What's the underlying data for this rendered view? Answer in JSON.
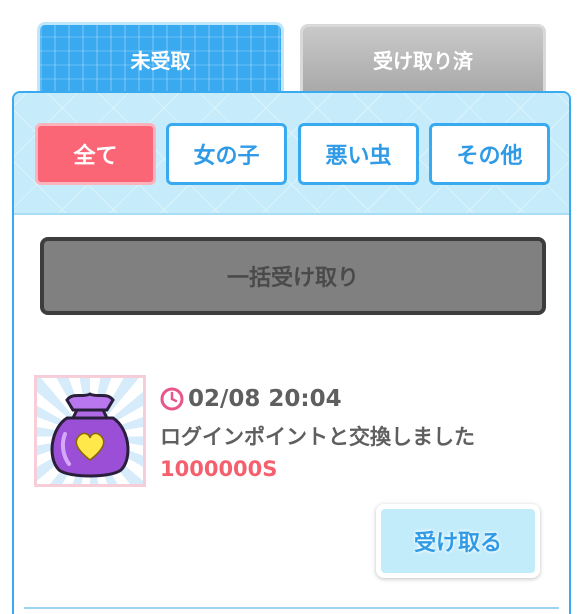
{
  "tabs": {
    "unreceived_label": "未受取",
    "received_label": "受け取り済"
  },
  "filters": [
    {
      "label": "全て",
      "selected": true
    },
    {
      "label": "女の子",
      "selected": false
    },
    {
      "label": "悪い虫",
      "selected": false
    },
    {
      "label": "その他",
      "selected": false
    }
  ],
  "bulk_receive_label": "一括受け取り",
  "items": [
    {
      "icon": "purple-heart-bag-icon",
      "time_icon": "clock-icon",
      "datetime": "02/08 20:04",
      "description": "ログインポイントと交換しました",
      "amount": "1000000S",
      "receive_label": "受け取る"
    }
  ],
  "colors": {
    "accent_blue": "#3aaaf0",
    "selected_pink": "#fb6676",
    "amount_red": "#f5606f",
    "panel_band": "#c6ecfb"
  }
}
